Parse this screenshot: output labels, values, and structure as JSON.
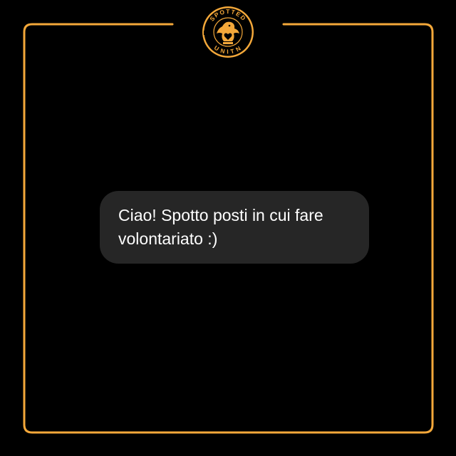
{
  "colors": {
    "background": "#000000",
    "accent": "#f4a83a",
    "bubble": "#262626",
    "text": "#ffffff"
  },
  "logo": {
    "top_text": "SPOTTED",
    "bottom_text": "UNITN",
    "icon": "eagle-heart-logo-icon"
  },
  "message": {
    "lines": [
      "Ciao! Spotto posti in cui fare",
      "volontariato :)"
    ]
  }
}
